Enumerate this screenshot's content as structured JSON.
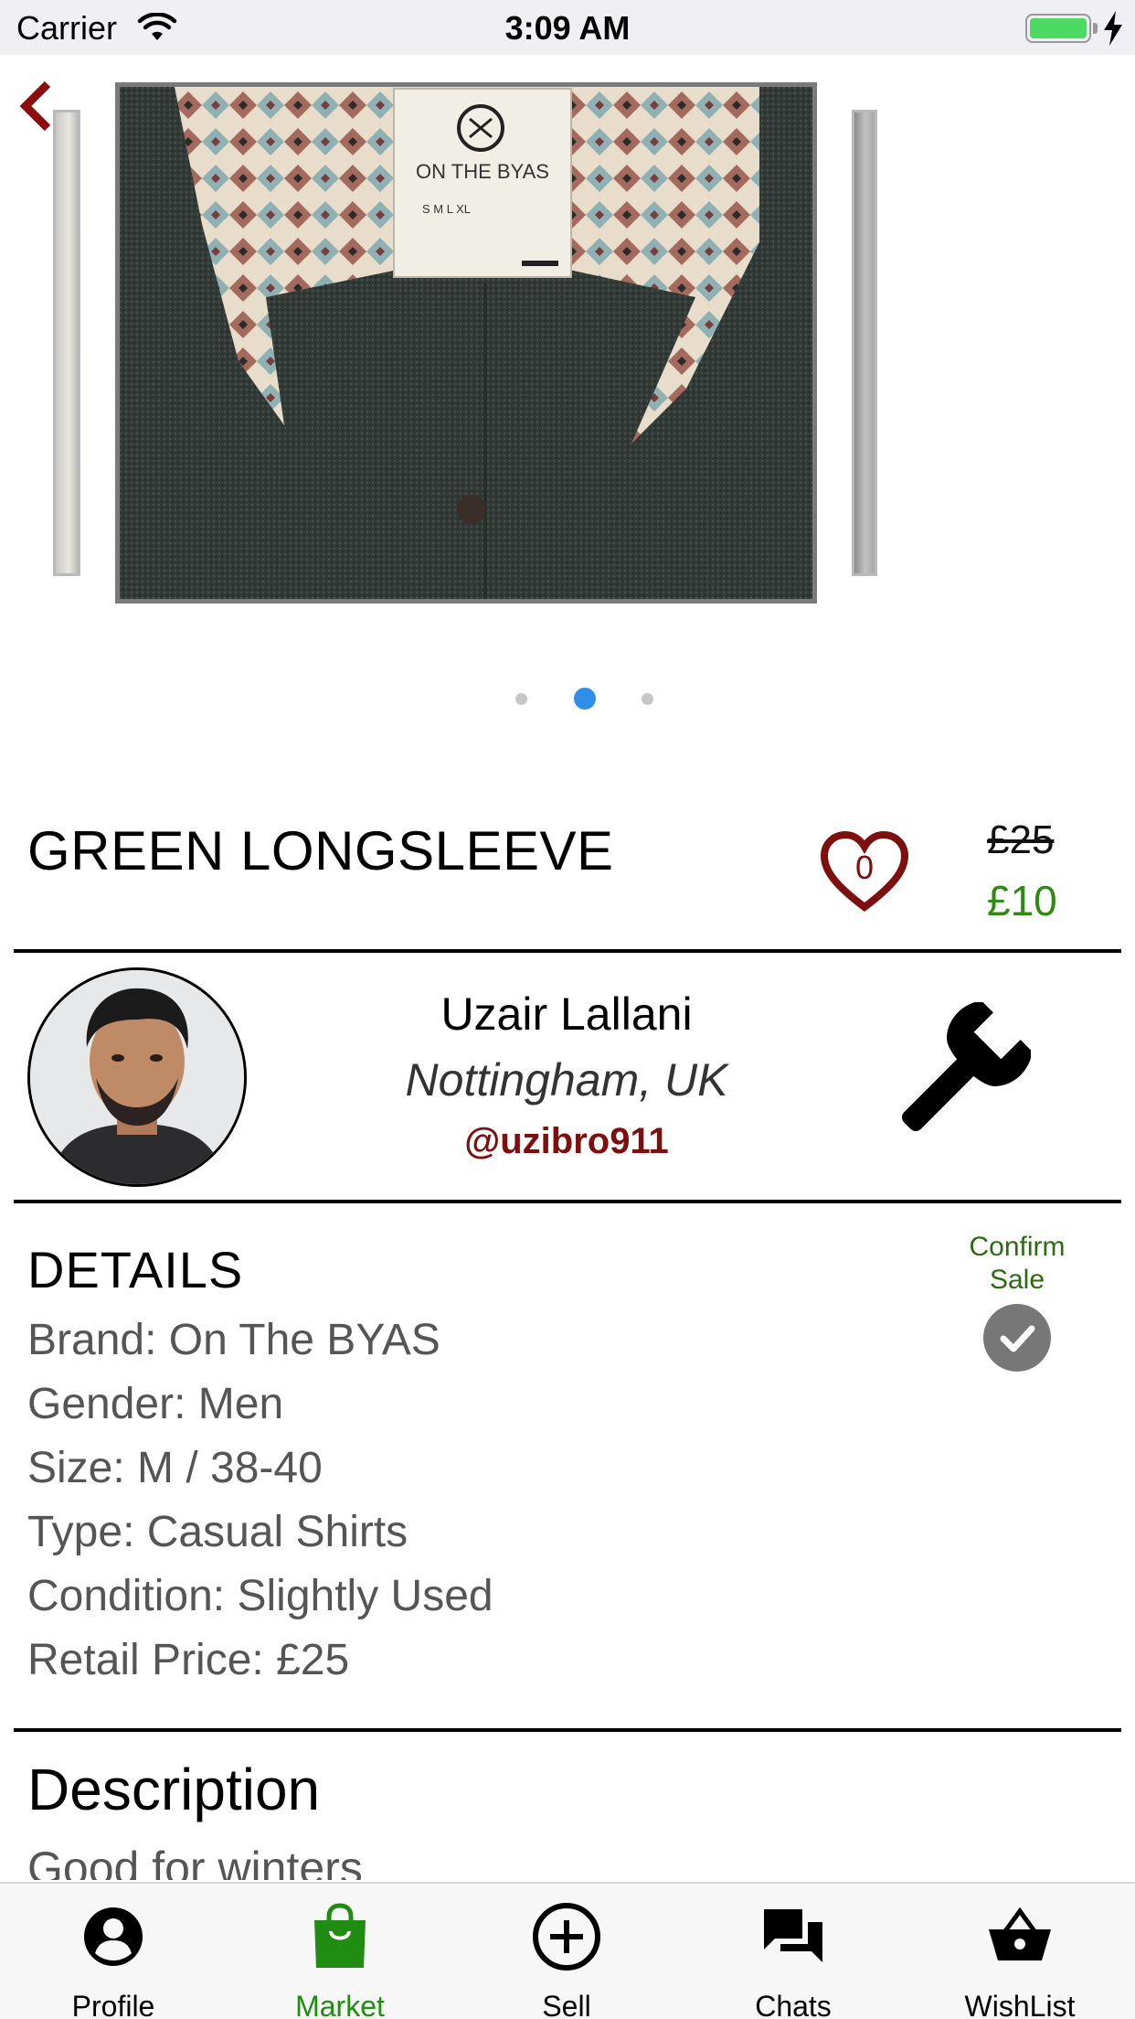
{
  "status_bar": {
    "carrier": "Carrier",
    "time": "3:09 AM"
  },
  "carousel": {
    "pages": 3,
    "active_page": 2
  },
  "item": {
    "title": "GREEN LONGSLEEVE",
    "like_count": "0",
    "original_price": "£25",
    "sale_price": "£10"
  },
  "seller": {
    "name": "Uzair Lallani",
    "location": "Nottingham, UK",
    "handle": "@uzibro911"
  },
  "details": {
    "heading": "DETAILS",
    "lines": [
      "Brand: On The BYAS",
      "Gender: Men",
      "Size: M / 38-40",
      "Type: Casual Shirts",
      "Condition: Slightly Used",
      "Retail Price: £25"
    ],
    "confirm_label": "Confirm Sale"
  },
  "description": {
    "heading": "Description",
    "text": "Good for winters"
  },
  "tabs": [
    {
      "label": "Profile",
      "icon": "profile-icon"
    },
    {
      "label": "Market",
      "icon": "shopping-bag-icon"
    },
    {
      "label": "Sell",
      "icon": "plus-circle-icon"
    },
    {
      "label": "Chats",
      "icon": "chat-icon"
    },
    {
      "label": "WishList",
      "icon": "basket-icon"
    }
  ],
  "active_tab": "Market",
  "colors": {
    "accent_red": "#7d0f0f",
    "price_green": "#2d8b12",
    "active_tab_green": "#1f8c12",
    "page_dot_active": "#2f8ee8"
  }
}
